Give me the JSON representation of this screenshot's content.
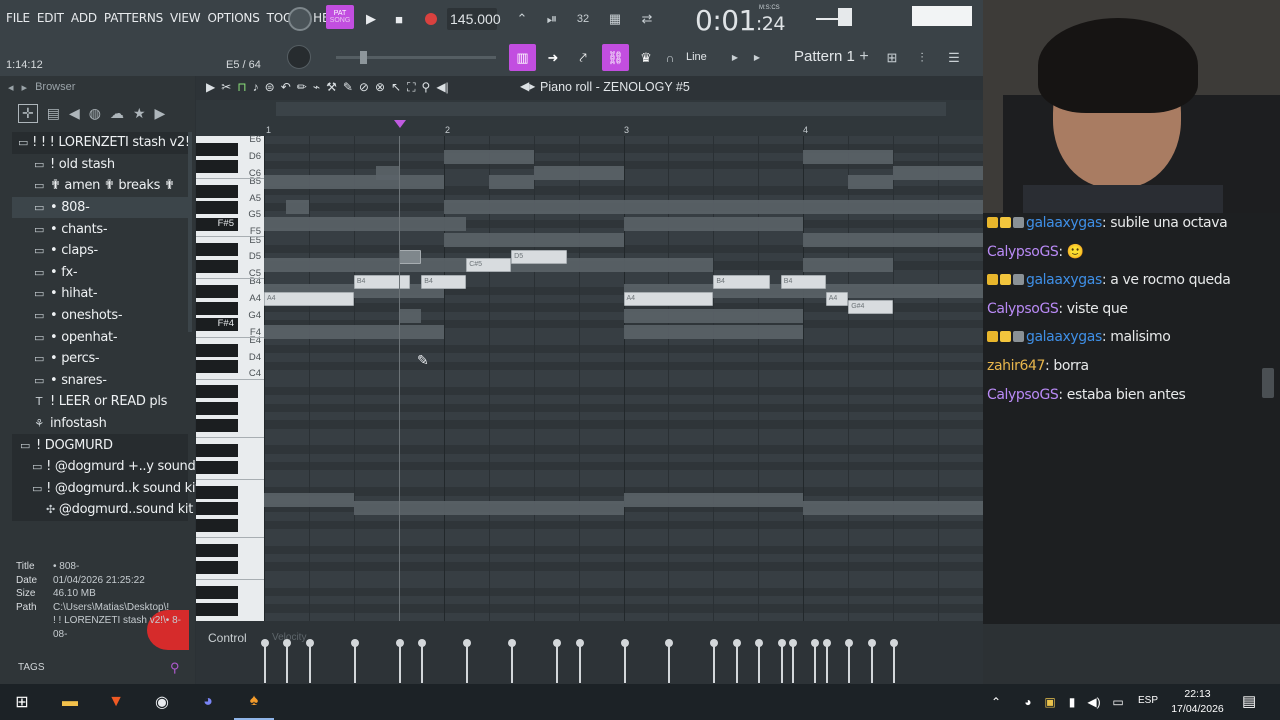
{
  "menu": [
    "FILE",
    "EDIT",
    "ADD",
    "PATTERNS",
    "VIEW",
    "OPTIONS",
    "TOOLS",
    "HELP"
  ],
  "transport": {
    "pat_label": "PAT",
    "song_label": "SONG",
    "tempo": "145.000",
    "time_main": "0:01",
    "time_sub": "24",
    "time_unit": "M:S:CS"
  },
  "hint": {
    "left": "1:14:12",
    "mid": "E5 / 64"
  },
  "toolbar": {
    "snap": "Line",
    "pattern": "Pattern 1"
  },
  "browser": {
    "header": "Browser",
    "items": [
      {
        "icon": "folder",
        "label": "! ! ! LORENZETI stash v2!",
        "indent": 0,
        "style": "dark"
      },
      {
        "icon": "folder",
        "label": "! old stash",
        "indent": 1,
        "style": "normal"
      },
      {
        "icon": "folder",
        "label": "✟ amen ✟ breaks ✟",
        "indent": 1,
        "style": "normal"
      },
      {
        "icon": "folder",
        "label": "• 808-",
        "indent": 1,
        "style": "sel"
      },
      {
        "icon": "folder",
        "label": "• chants-",
        "indent": 1,
        "style": "normal"
      },
      {
        "icon": "folder",
        "label": "• claps-",
        "indent": 1,
        "style": "normal"
      },
      {
        "icon": "folder",
        "label": "• fx-",
        "indent": 1,
        "style": "normal"
      },
      {
        "icon": "folder",
        "label": "• hihat-",
        "indent": 1,
        "style": "normal"
      },
      {
        "icon": "folder",
        "label": "• oneshots-",
        "indent": 1,
        "style": "normal"
      },
      {
        "icon": "folder",
        "label": "• openhat-",
        "indent": 1,
        "style": "normal"
      },
      {
        "icon": "folder",
        "label": "• percs-",
        "indent": 1,
        "style": "normal"
      },
      {
        "icon": "folder",
        "label": "• snares-",
        "indent": 1,
        "style": "normal"
      },
      {
        "icon": "text",
        "label": "! LEER or READ pls",
        "indent": 1,
        "style": "normal"
      },
      {
        "icon": "plug",
        "label": "infostash",
        "indent": 1,
        "style": "normal"
      },
      {
        "icon": "folder",
        "label": "! DOGMURD",
        "indent": 0,
        "style": "dark"
      },
      {
        "icon": "folder",
        "label": "! @dogmurd +..y sound kit",
        "indent": 1,
        "style": "dark"
      },
      {
        "icon": "folder",
        "label": "! @dogmurd..k sound kit",
        "indent": 1,
        "style": "dark"
      },
      {
        "icon": "link",
        "label": "@dogmurd..sound kit",
        "indent": 2,
        "style": "dark"
      }
    ],
    "info": {
      "title_k": "Title",
      "title_v": "• 808-",
      "date_k": "Date",
      "date_v": "01/04/2026 21:25:22",
      "size_k": "Size",
      "size_v": "46.10 MB",
      "path_k": "Path",
      "path_v1": "C:\\Users\\Matias\\Desktop\\!",
      "path_v2": "! ! LORENZETI stash v2!\\• 8-",
      "path_v3": "08-"
    },
    "tags_label": "TAGS"
  },
  "pianoroll": {
    "title": "Piano roll - ZENOLOGY #5",
    "bars": [
      "1",
      "2",
      "3",
      "4"
    ],
    "key_labels": [
      "E6",
      "D6",
      "C6",
      "B5",
      "A5",
      "G5",
      "F#5",
      "F5",
      "E5",
      "D5",
      "C5",
      "B4",
      "A4",
      "G4",
      "F#4",
      "F4",
      "E4",
      "D4",
      "C4"
    ],
    "notes": [
      {
        "label": "A4",
        "start": 0,
        "len": 2,
        "pitch": "A4"
      },
      {
        "label": "B4",
        "start": 2,
        "len": 1.25,
        "pitch": "B4"
      },
      {
        "label": "",
        "start": 3,
        "len": 0.5,
        "pitch": "D5"
      },
      {
        "label": "B4",
        "start": 3.5,
        "len": 1,
        "pitch": "B4"
      },
      {
        "label": "C#5",
        "start": 4.5,
        "len": 1,
        "pitch": "C#5"
      },
      {
        "label": "D5",
        "start": 5.5,
        "len": 1.25,
        "pitch": "D5"
      },
      {
        "label": "A4",
        "start": 8,
        "len": 2,
        "pitch": "A4"
      },
      {
        "label": "B4",
        "start": 10,
        "len": 1.25,
        "pitch": "B4"
      },
      {
        "label": "B4",
        "start": 11.5,
        "len": 1,
        "pitch": "B4"
      },
      {
        "label": "A4",
        "start": 12.5,
        "len": 0.5,
        "pitch": "A4"
      },
      {
        "label": "G#4",
        "start": 13,
        "len": 1,
        "pitch": "G#4"
      }
    ],
    "control_label": "Control",
    "control_sub": "Velocity"
  },
  "chat": [
    {
      "user": "galaaxygas",
      "color": "#3f8fe6",
      "badges": true,
      "text": "subile una octava"
    },
    {
      "user": "CalypsoGS",
      "color": "#b98af5",
      "badges": false,
      "text": "🙂"
    },
    {
      "user": "galaaxygas",
      "color": "#3f8fe6",
      "badges": true,
      "text": "a ve rocmo queda"
    },
    {
      "user": "CalypsoGS",
      "color": "#b98af5",
      "badges": false,
      "text": "viste que"
    },
    {
      "user": "galaaxygas",
      "color": "#3f8fe6",
      "badges": true,
      "text": "malisimo"
    },
    {
      "user": "zahir647",
      "color": "#e8b64c",
      "badges": false,
      "text": "borra"
    },
    {
      "user": "CalypsoGS",
      "color": "#b98af5",
      "badges": false,
      "text": "estaba bien antes"
    }
  ],
  "taskbar": {
    "lang": "ESP",
    "time": "22:13",
    "date": "17/04/2026"
  },
  "colors": {
    "accent": "#c24ee0",
    "chat_bg": "#1d1f21",
    "note": "#d8dcdf"
  }
}
